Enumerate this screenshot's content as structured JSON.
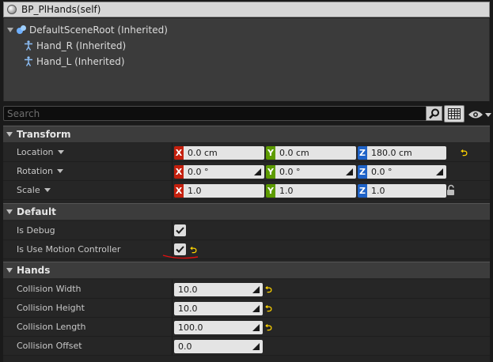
{
  "component_header": {
    "title": "BP_PlHands(self)",
    "icon": "sphere-icon"
  },
  "tree": [
    {
      "label": "DefaultSceneRoot (Inherited)",
      "icon": "scene-root-icon"
    },
    {
      "label": "Hand_R (Inherited)",
      "icon": "skeletal-mesh-icon"
    },
    {
      "label": "Hand_L (Inherited)",
      "icon": "skeletal-mesh-icon"
    }
  ],
  "search": {
    "placeholder": "Search",
    "value": ""
  },
  "sections": {
    "transform": {
      "title": "Transform"
    },
    "default": {
      "title": "Default"
    },
    "hands": {
      "title": "Hands"
    }
  },
  "transform": {
    "location": {
      "label": "Location",
      "x": "0.0 cm",
      "y": "0.0 cm",
      "z": "180.0 cm"
    },
    "rotation": {
      "label": "Rotation",
      "x": "0.0 °",
      "y": "0.0 °",
      "z": "0.0 °"
    },
    "scale": {
      "label": "Scale",
      "x": "1.0",
      "y": "1.0",
      "z": "1.0"
    }
  },
  "axes": {
    "x": "X",
    "y": "Y",
    "z": "Z"
  },
  "default": {
    "is_debug": {
      "label": "Is Debug",
      "checked": true
    },
    "is_use_motion_controller": {
      "label": "Is Use Motion Controller",
      "checked": true
    }
  },
  "hands": {
    "collision_width": {
      "label": "Collision Width",
      "value": "10.0"
    },
    "collision_height": {
      "label": "Collision Height",
      "value": "10.0"
    },
    "collision_length": {
      "label": "Collision Length",
      "value": "100.0"
    },
    "collision_offset": {
      "label": "Collision Offset",
      "value": "0.0"
    }
  },
  "colors": {
    "axis_x": "#c4200e",
    "axis_y": "#5d9b00",
    "axis_z": "#1f63c8",
    "reset_arrow": "#ffd400",
    "annotation": "#e01010"
  }
}
